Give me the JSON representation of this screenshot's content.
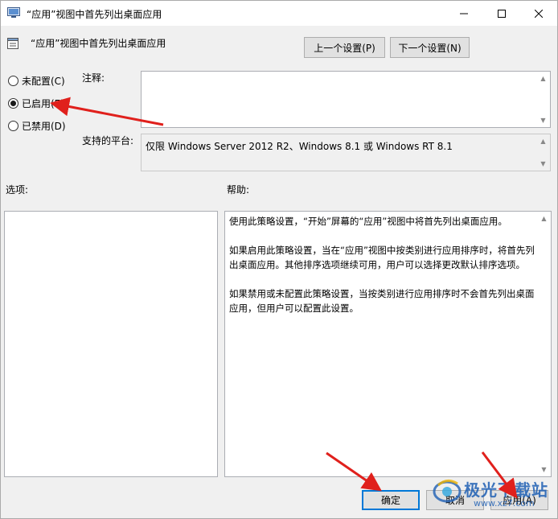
{
  "window": {
    "title": "“应用”视图中首先列出桌面应用",
    "controls": {
      "minimize": "—",
      "maximize": "☐",
      "close": "✕"
    }
  },
  "header": {
    "policy_title": "“应用”视图中首先列出桌面应用",
    "prev_button": "上一个设置(P)",
    "next_button": "下一个设置(N)"
  },
  "state": {
    "options": [
      {
        "label": "未配置(C)",
        "selected": false
      },
      {
        "label": "已启用(E)",
        "selected": true
      },
      {
        "label": "已禁用(D)",
        "selected": false
      }
    ]
  },
  "comment": {
    "label": "注释:",
    "value": ""
  },
  "platform": {
    "label": "支持的平台:",
    "value": "仅限 Windows Server 2012 R2、Windows 8.1 或 Windows RT 8.1"
  },
  "options_section": {
    "label": "选项:"
  },
  "help_section": {
    "label": "帮助:",
    "paragraphs": [
      "使用此策略设置，“开始”屏幕的“应用”视图中将首先列出桌面应用。",
      "如果启用此策略设置，当在“应用”视图中按类别进行应用排序时，将首先列出桌面应用。其他排序选项继续可用，用户可以选择更改默认排序选项。",
      "如果禁用或未配置此策略设置，当按类别进行应用排序时不会首先列出桌面应用，但用户可以配置此设置。"
    ]
  },
  "footer": {
    "ok": "确定",
    "cancel": "取消",
    "apply": "应用(A)"
  },
  "watermark": {
    "text": "极光下载站",
    "sub": "www.xz7.com"
  },
  "colors": {
    "accent": "#0078d7",
    "arrow": "#e0201c",
    "watermark": "#1e5fb4"
  }
}
